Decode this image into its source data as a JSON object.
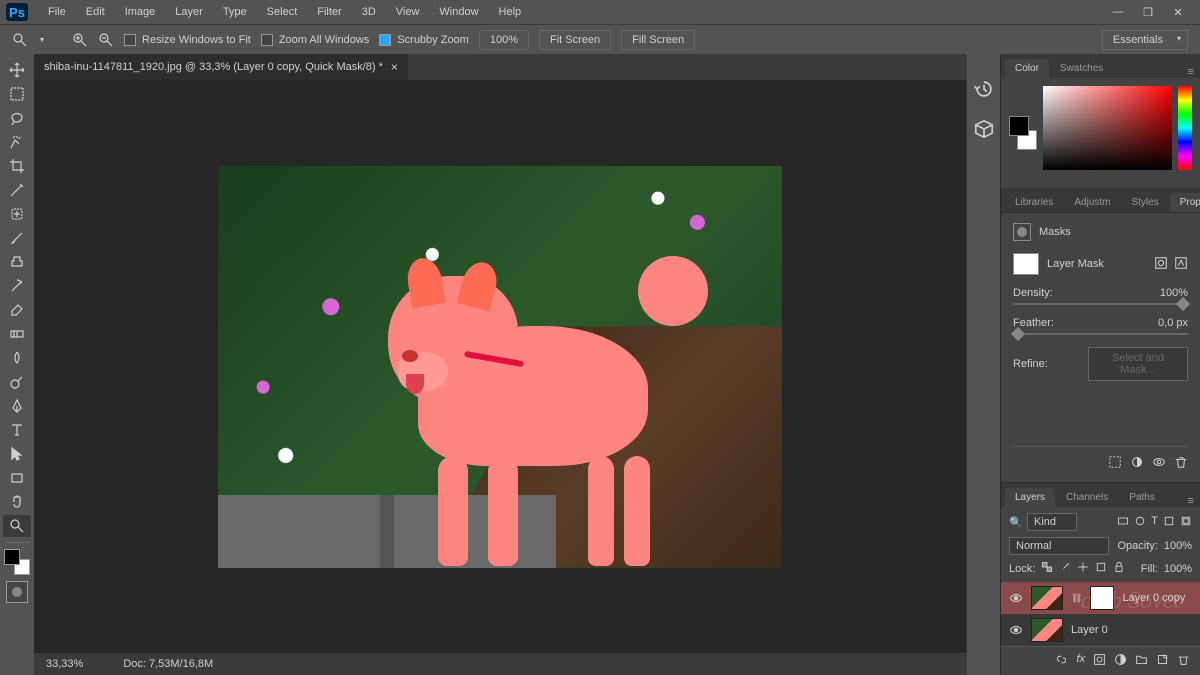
{
  "app": {
    "logo": "Ps"
  },
  "menu": [
    "File",
    "Edit",
    "Image",
    "Layer",
    "Type",
    "Select",
    "Filter",
    "3D",
    "View",
    "Window",
    "Help"
  ],
  "options": {
    "resize_windows": "Resize Windows to Fit",
    "zoom_all": "Zoom All Windows",
    "scrubby": "Scrubby Zoom",
    "zoom_level": "100%",
    "fit_screen": "Fit Screen",
    "fill_screen": "Fill Screen",
    "workspace": "Essentials"
  },
  "document": {
    "tab_title": "shiba-inu-1147811_1920.jpg @ 33,3% (Layer 0 copy, Quick Mask/8) *",
    "zoom_status": "33,33%",
    "doc_info": "Doc: 7,53M/16,8M"
  },
  "panels": {
    "color": {
      "tab_color": "Color",
      "tab_swatches": "Swatches"
    },
    "props_tabs": {
      "libraries": "Libraries",
      "adjustments": "Adjustm",
      "styles": "Styles",
      "properties": "Properties"
    },
    "props": {
      "masks_label": "Masks",
      "layer_mask_label": "Layer Mask",
      "density_label": "Density:",
      "density_value": "100%",
      "feather_label": "Feather:",
      "feather_value": "0,0 px",
      "refine_label": "Refine:",
      "select_mask_btn": "Select and Mask..."
    },
    "layers_tabs": {
      "layers": "Layers",
      "channels": "Channels",
      "paths": "Paths"
    },
    "layers": {
      "kind_label": "Kind",
      "blend_mode": "Normal",
      "opacity_label": "Opacity:",
      "opacity_value": "100%",
      "lock_label": "Lock:",
      "fill_label": "Fill:",
      "fill_value": "100%",
      "items": [
        {
          "name": "Layer 0 copy",
          "selected": true,
          "has_mask": true
        },
        {
          "name": "Layer 0",
          "selected": false,
          "has_mask": false
        }
      ]
    }
  },
  "watermark": "club Sovet"
}
